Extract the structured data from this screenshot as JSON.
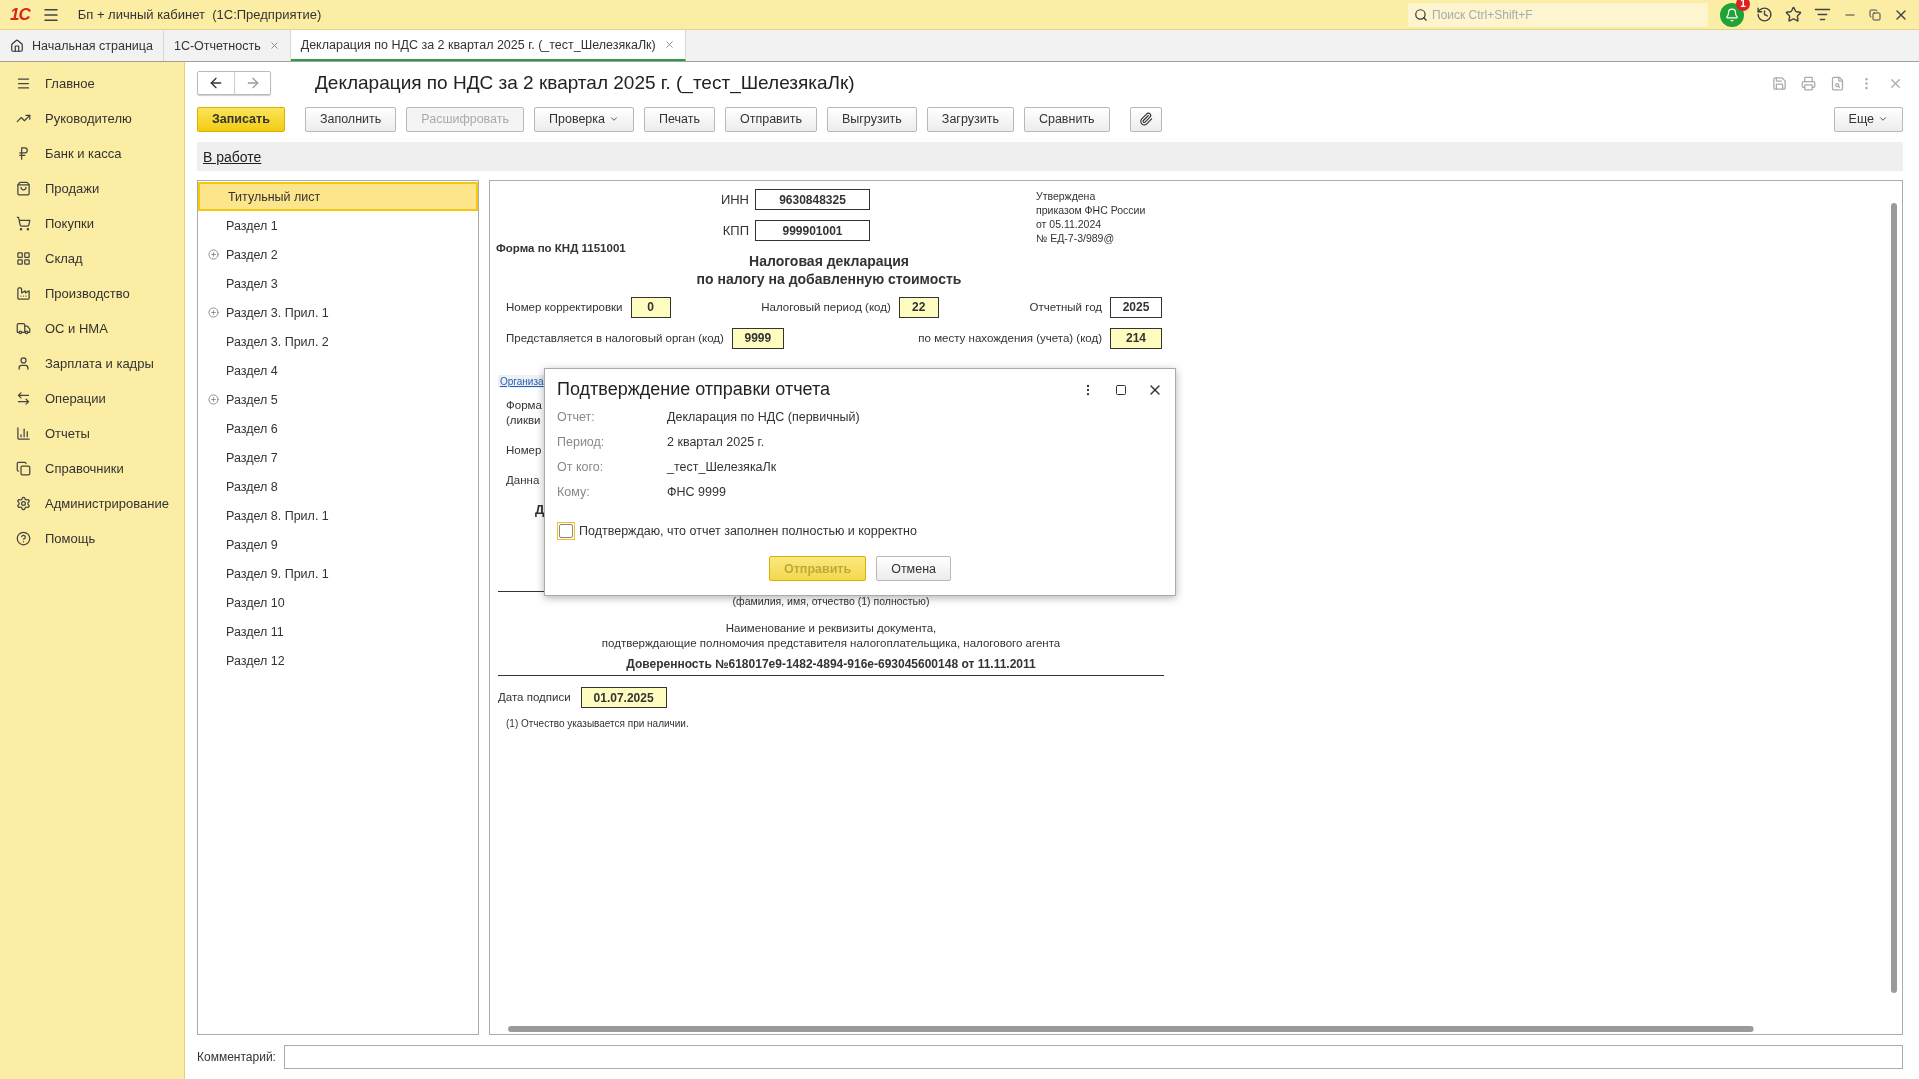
{
  "app_bar": {
    "logo": "1С",
    "title": "Бп + личный кабинет  (1С:Предприятие)",
    "search": {
      "placeholder": "Поиск Ctrl+Shift+F"
    },
    "notifications": "1"
  },
  "tabs": [
    {
      "label": "Начальная страница",
      "kind": "home",
      "selected": false
    },
    {
      "label": "1С-Отчетность",
      "kind": "doc",
      "selected": false
    },
    {
      "label": "Декларация по НДС за 2 квартал 2025 г. (_тест_ШелезякаЛк)",
      "kind": "doc",
      "selected": true
    }
  ],
  "sidebar": {
    "items": [
      {
        "label": "Главное"
      },
      {
        "label": "Руководителю"
      },
      {
        "label": "Банк и касса"
      },
      {
        "label": "Продажи"
      },
      {
        "label": "Покупки"
      },
      {
        "label": "Склад"
      },
      {
        "label": "Производство"
      },
      {
        "label": "ОС и НМА"
      },
      {
        "label": "Зарплата и кадры"
      },
      {
        "label": "Операции"
      },
      {
        "label": "Отчеты"
      },
      {
        "label": "Справочники"
      },
      {
        "label": "Администрирование"
      },
      {
        "label": "Помощь"
      }
    ]
  },
  "document": {
    "title": "Декларация по НДС за 2 квартал 2025 г. (_тест_ШелезякаЛк)",
    "toolbar": [
      {
        "label": "Записать",
        "kind": "primary",
        "disabled": false
      },
      {
        "label": "Заполнить",
        "kind": "plain",
        "disabled": false
      },
      {
        "label": "Расшифровать",
        "kind": "plain",
        "disabled": true
      },
      {
        "label": "Проверка",
        "kind": "menu",
        "disabled": false
      },
      {
        "label": "Печать",
        "kind": "plain",
        "disabled": false
      },
      {
        "label": "Отправить",
        "kind": "plain",
        "disabled": false
      },
      {
        "label": "Выгрузить",
        "kind": "plain",
        "disabled": false
      },
      {
        "label": "Загрузить",
        "kind": "plain",
        "disabled": false
      },
      {
        "label": "Сравнить",
        "kind": "plain",
        "disabled": false
      },
      {
        "kind": "attach",
        "disabled": false
      }
    ],
    "more_button": "Еще",
    "status_link": "В работе",
    "sections": [
      {
        "label": "Титульный лист",
        "kind": "leaf",
        "selected": true
      },
      {
        "label": "Раздел 1",
        "kind": "leaf",
        "selected": false
      },
      {
        "label": "Раздел 2",
        "kind": "group",
        "selected": false
      },
      {
        "label": "Раздел 3",
        "kind": "leaf",
        "selected": false
      },
      {
        "label": "Раздел 3. Прил. 1",
        "kind": "group",
        "selected": false
      },
      {
        "label": "Раздел 3. Прил. 2",
        "kind": "leaf",
        "selected": false
      },
      {
        "label": "Раздел 4",
        "kind": "leaf",
        "selected": false
      },
      {
        "label": "Раздел 5",
        "kind": "group",
        "selected": false
      },
      {
        "label": "Раздел 6",
        "kind": "leaf",
        "selected": false
      },
      {
        "label": "Раздел 7",
        "kind": "leaf",
        "selected": false
      },
      {
        "label": "Раздел 8",
        "kind": "leaf",
        "selected": false
      },
      {
        "label": "Раздел 8. Прил. 1",
        "kind": "leaf",
        "selected": false
      },
      {
        "label": "Раздел 9",
        "kind": "leaf",
        "selected": false
      },
      {
        "label": "Раздел 9. Прил. 1",
        "kind": "leaf",
        "selected": false
      },
      {
        "label": "Раздел 10",
        "kind": "leaf",
        "selected": false
      },
      {
        "label": "Раздел 11",
        "kind": "leaf",
        "selected": false
      },
      {
        "label": "Раздел 12",
        "kind": "leaf",
        "selected": false
      }
    ],
    "form": {
      "inn": {
        "label": "ИНН",
        "value": "9630848325",
        "editable": false
      },
      "kpp": {
        "label": "КПП",
        "value": "999901001",
        "editable": false
      },
      "approval": [
        "Утверждена",
        "приказом ФНС России",
        "от 05.11.2024",
        "№ ЕД-7-3/989@"
      ],
      "knd": "Форма по КНД 1151001",
      "heading": [
        "Налоговая декларация",
        "по налогу на добавленную стоимость"
      ],
      "row_1": [
        {
          "label": "Номер корректировки",
          "value": "0",
          "editable": true
        },
        {
          "label": "Налоговый период (код)",
          "value": "22",
          "editable": true
        },
        {
          "label": "Отчетный год",
          "value": "2025",
          "editable": false
        }
      ],
      "row_2": [
        {
          "label": "Представляется в налоговый орган (код)",
          "value": "9999",
          "editable": true
        },
        {
          "label": "по месту нахождения (учета) (код)",
          "value": "214",
          "editable": true
        }
      ],
      "org_link": "Организа",
      "covered_texts": [
        "Форма",
        "(ликви",
        "Номер",
        "Данна"
      ],
      "covered_bold": "Д",
      "name_hint": "(фамилия, имя, отчество (1)  полностью)",
      "doc_caption": [
        "Наименование и реквизиты документа,",
        "подтверждающие полномочия представителя налогоплательщика, налогового агента"
      ],
      "power_of_attorney": "Доверенность №618017е9-1482-4894-916е-693045600148 от 11.11.2011",
      "sign_date": {
        "label": "Дата подписи",
        "value": "01.07.2025",
        "editable": true
      },
      "footnote": "(1) Отчество указывается при наличии."
    },
    "comment": {
      "label": "Комментарий:"
    }
  },
  "dialog": {
    "title": "Подтверждение отправки отчета",
    "fields": [
      {
        "label": "Отчет:",
        "value": "Декларация по НДС (первичный)"
      },
      {
        "label": "Период:",
        "value": "2 квартал 2025 г."
      },
      {
        "label": "От кого:",
        "value": "_тест_ШелезякаЛк"
      },
      {
        "label": "Кому:",
        "value": "ФНС 9999"
      }
    ],
    "confirm": {
      "label": "Подтверждаю, что отчет заполнен полностью и корректно",
      "checked": false
    },
    "buttons": [
      {
        "label": "Отправить",
        "kind": "primary",
        "disabled": true
      },
      {
        "label": "Отмена",
        "kind": "plain",
        "disabled": false
      }
    ]
  }
}
